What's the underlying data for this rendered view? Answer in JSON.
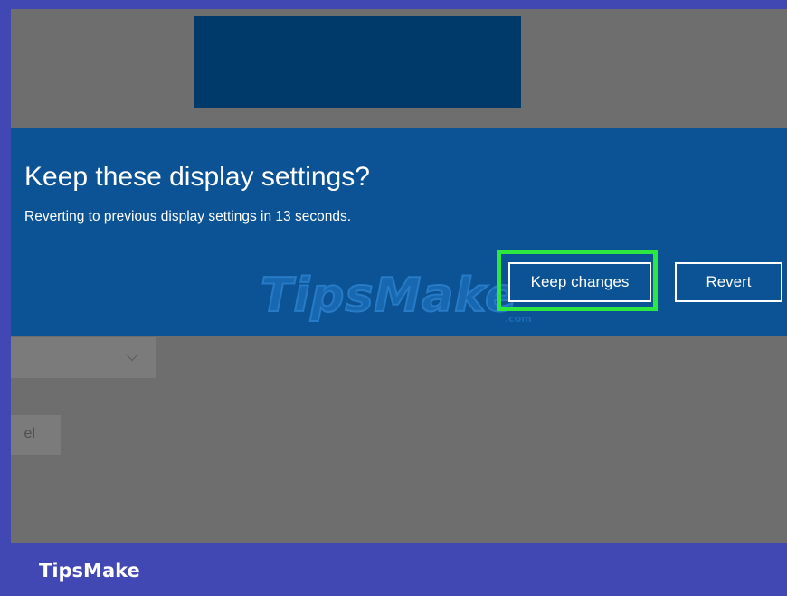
{
  "dialog": {
    "title": "Keep these display settings?",
    "message": "Reverting to previous display settings in 13 seconds.",
    "keep_label": "Keep changes",
    "revert_label": "Revert"
  },
  "background": {
    "cancel_partial": "el"
  },
  "watermark": {
    "logo_text": "TipsMake",
    "logo_suffix": ".com"
  },
  "footer": {
    "brand": "TipsMake"
  },
  "colors": {
    "frame": "#4148b4",
    "dialog": "#0b5394",
    "screen": "#6e6e6e",
    "highlight": "#2ee640"
  },
  "icons": [
    "chevron-down-icon"
  ]
}
